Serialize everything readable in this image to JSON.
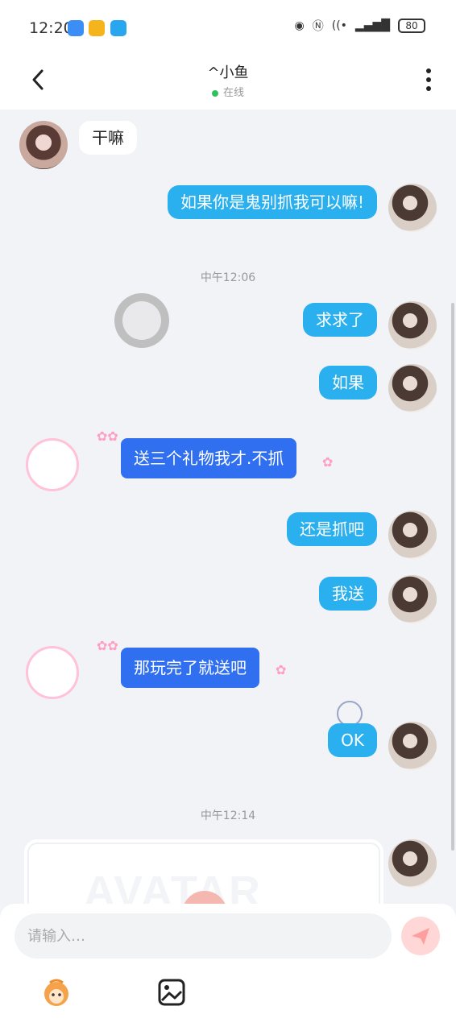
{
  "status": {
    "time": "12:20",
    "battery": "80"
  },
  "header": {
    "title": "^小鱼",
    "status": "在线"
  },
  "messages": [
    {
      "text": "干嘛"
    },
    {
      "text": "如果你是鬼别抓我可以嘛!"
    },
    {
      "text": "求求了"
    },
    {
      "text": "如果"
    },
    {
      "text": "送三个礼物我才.不抓"
    },
    {
      "text": "还是抓吧"
    },
    {
      "text": "我送"
    },
    {
      "text": "那玩完了就送吧"
    },
    {
      "text": "OK"
    }
  ],
  "timestamps": [
    "中午12:06",
    "中午12:14"
  ],
  "card": {
    "text": "AVATAR"
  },
  "input": {
    "placeholder": "请输入…"
  },
  "colors": {
    "my_bubble": "#2ab0ef",
    "her_bubble": "#2f6ff0",
    "online": "#2fc25b"
  }
}
